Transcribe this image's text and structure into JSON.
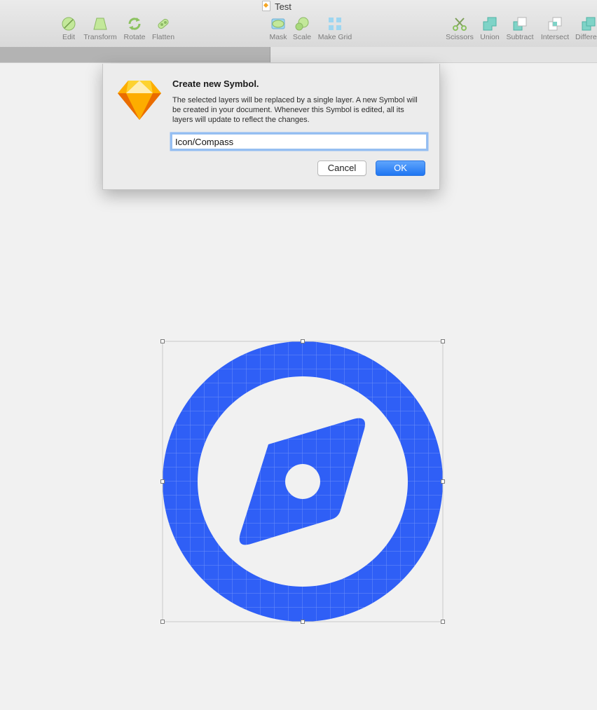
{
  "window": {
    "title": "Test",
    "doc_icon": "sketch-document-icon"
  },
  "toolbar": {
    "left_tools": [
      {
        "label": "Edit",
        "icon": "edit-icon"
      },
      {
        "label": "Transform",
        "icon": "transform-icon"
      },
      {
        "label": "Rotate",
        "icon": "rotate-icon"
      },
      {
        "label": "Flatten",
        "icon": "flatten-icon"
      }
    ],
    "middle_tools": [
      {
        "label": "Mask",
        "icon": "mask-icon"
      },
      {
        "label": "Scale",
        "icon": "scale-icon"
      },
      {
        "label": "Make Grid",
        "icon": "make-grid-icon"
      }
    ],
    "right_tools": [
      {
        "label": "Scissors",
        "icon": "scissors-icon"
      },
      {
        "label": "Union",
        "icon": "union-icon"
      },
      {
        "label": "Subtract",
        "icon": "subtract-icon"
      },
      {
        "label": "Intersect",
        "icon": "intersect-icon"
      },
      {
        "label": "Differe",
        "icon": "difference-icon"
      }
    ]
  },
  "dialog": {
    "title": "Create new Symbol.",
    "message": "The selected layers will be replaced by a single layer. A new Symbol will be created in your document. Whenever this Symbol is edited, all its layers will update to reflect the changes.",
    "input_value": "Icon/Compass",
    "cancel_label": "Cancel",
    "ok_label": "OK",
    "logo": "sketch-diamond-icon"
  },
  "canvas": {
    "shape": "compass-icon",
    "fill_color": "#2f5ff6",
    "grid_color": "#6e8ff8",
    "selection": true
  }
}
